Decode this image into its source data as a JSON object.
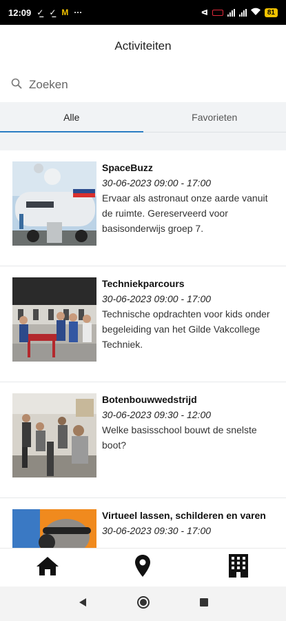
{
  "status_bar": {
    "time": "12:09",
    "notification_icons": [
      "download-done-icon",
      "download-done-icon",
      "mcdonalds-icon",
      "more-icon"
    ],
    "battery": "81"
  },
  "header": {
    "title": "Activiteiten"
  },
  "search": {
    "placeholder": "Zoeken"
  },
  "tabs": [
    {
      "label": "Alle",
      "active": true
    },
    {
      "label": "Favorieten",
      "active": false
    }
  ],
  "activities": [
    {
      "title": "SpaceBuzz",
      "date": "30-06-2023 09:00 - 17:00",
      "description": "Ervaar als astronaut onze aarde vanuit de ruimte. Gereserveerd voor basisonderwijs groep 7."
    },
    {
      "title": "Techniekparcours",
      "date": "30-06-2023 09:00 - 17:00",
      "description": "Technische opdrachten voor kids onder begeleiding van het Gilde Vakcollege Techniek."
    },
    {
      "title": "Botenbouwwedstrijd",
      "date": "30-06-2023 09:30 - 12:00",
      "description": "Welke basisschool bouwt de snelste boot?"
    },
    {
      "title": "Virtueel lassen, schilderen en varen",
      "date": "30-06-2023 09:30 - 17:00",
      "description": ""
    }
  ],
  "bottom_nav": [
    {
      "icon": "home-icon"
    },
    {
      "icon": "location-pin-icon"
    },
    {
      "icon": "building-icon"
    }
  ],
  "android_nav": [
    {
      "icon": "back-triangle-icon"
    },
    {
      "icon": "home-circle-icon"
    },
    {
      "icon": "recents-square-icon"
    }
  ],
  "colors": {
    "accent": "#2a7dc3",
    "tab_background": "#f1f3f5",
    "status_bar": "#000000"
  }
}
